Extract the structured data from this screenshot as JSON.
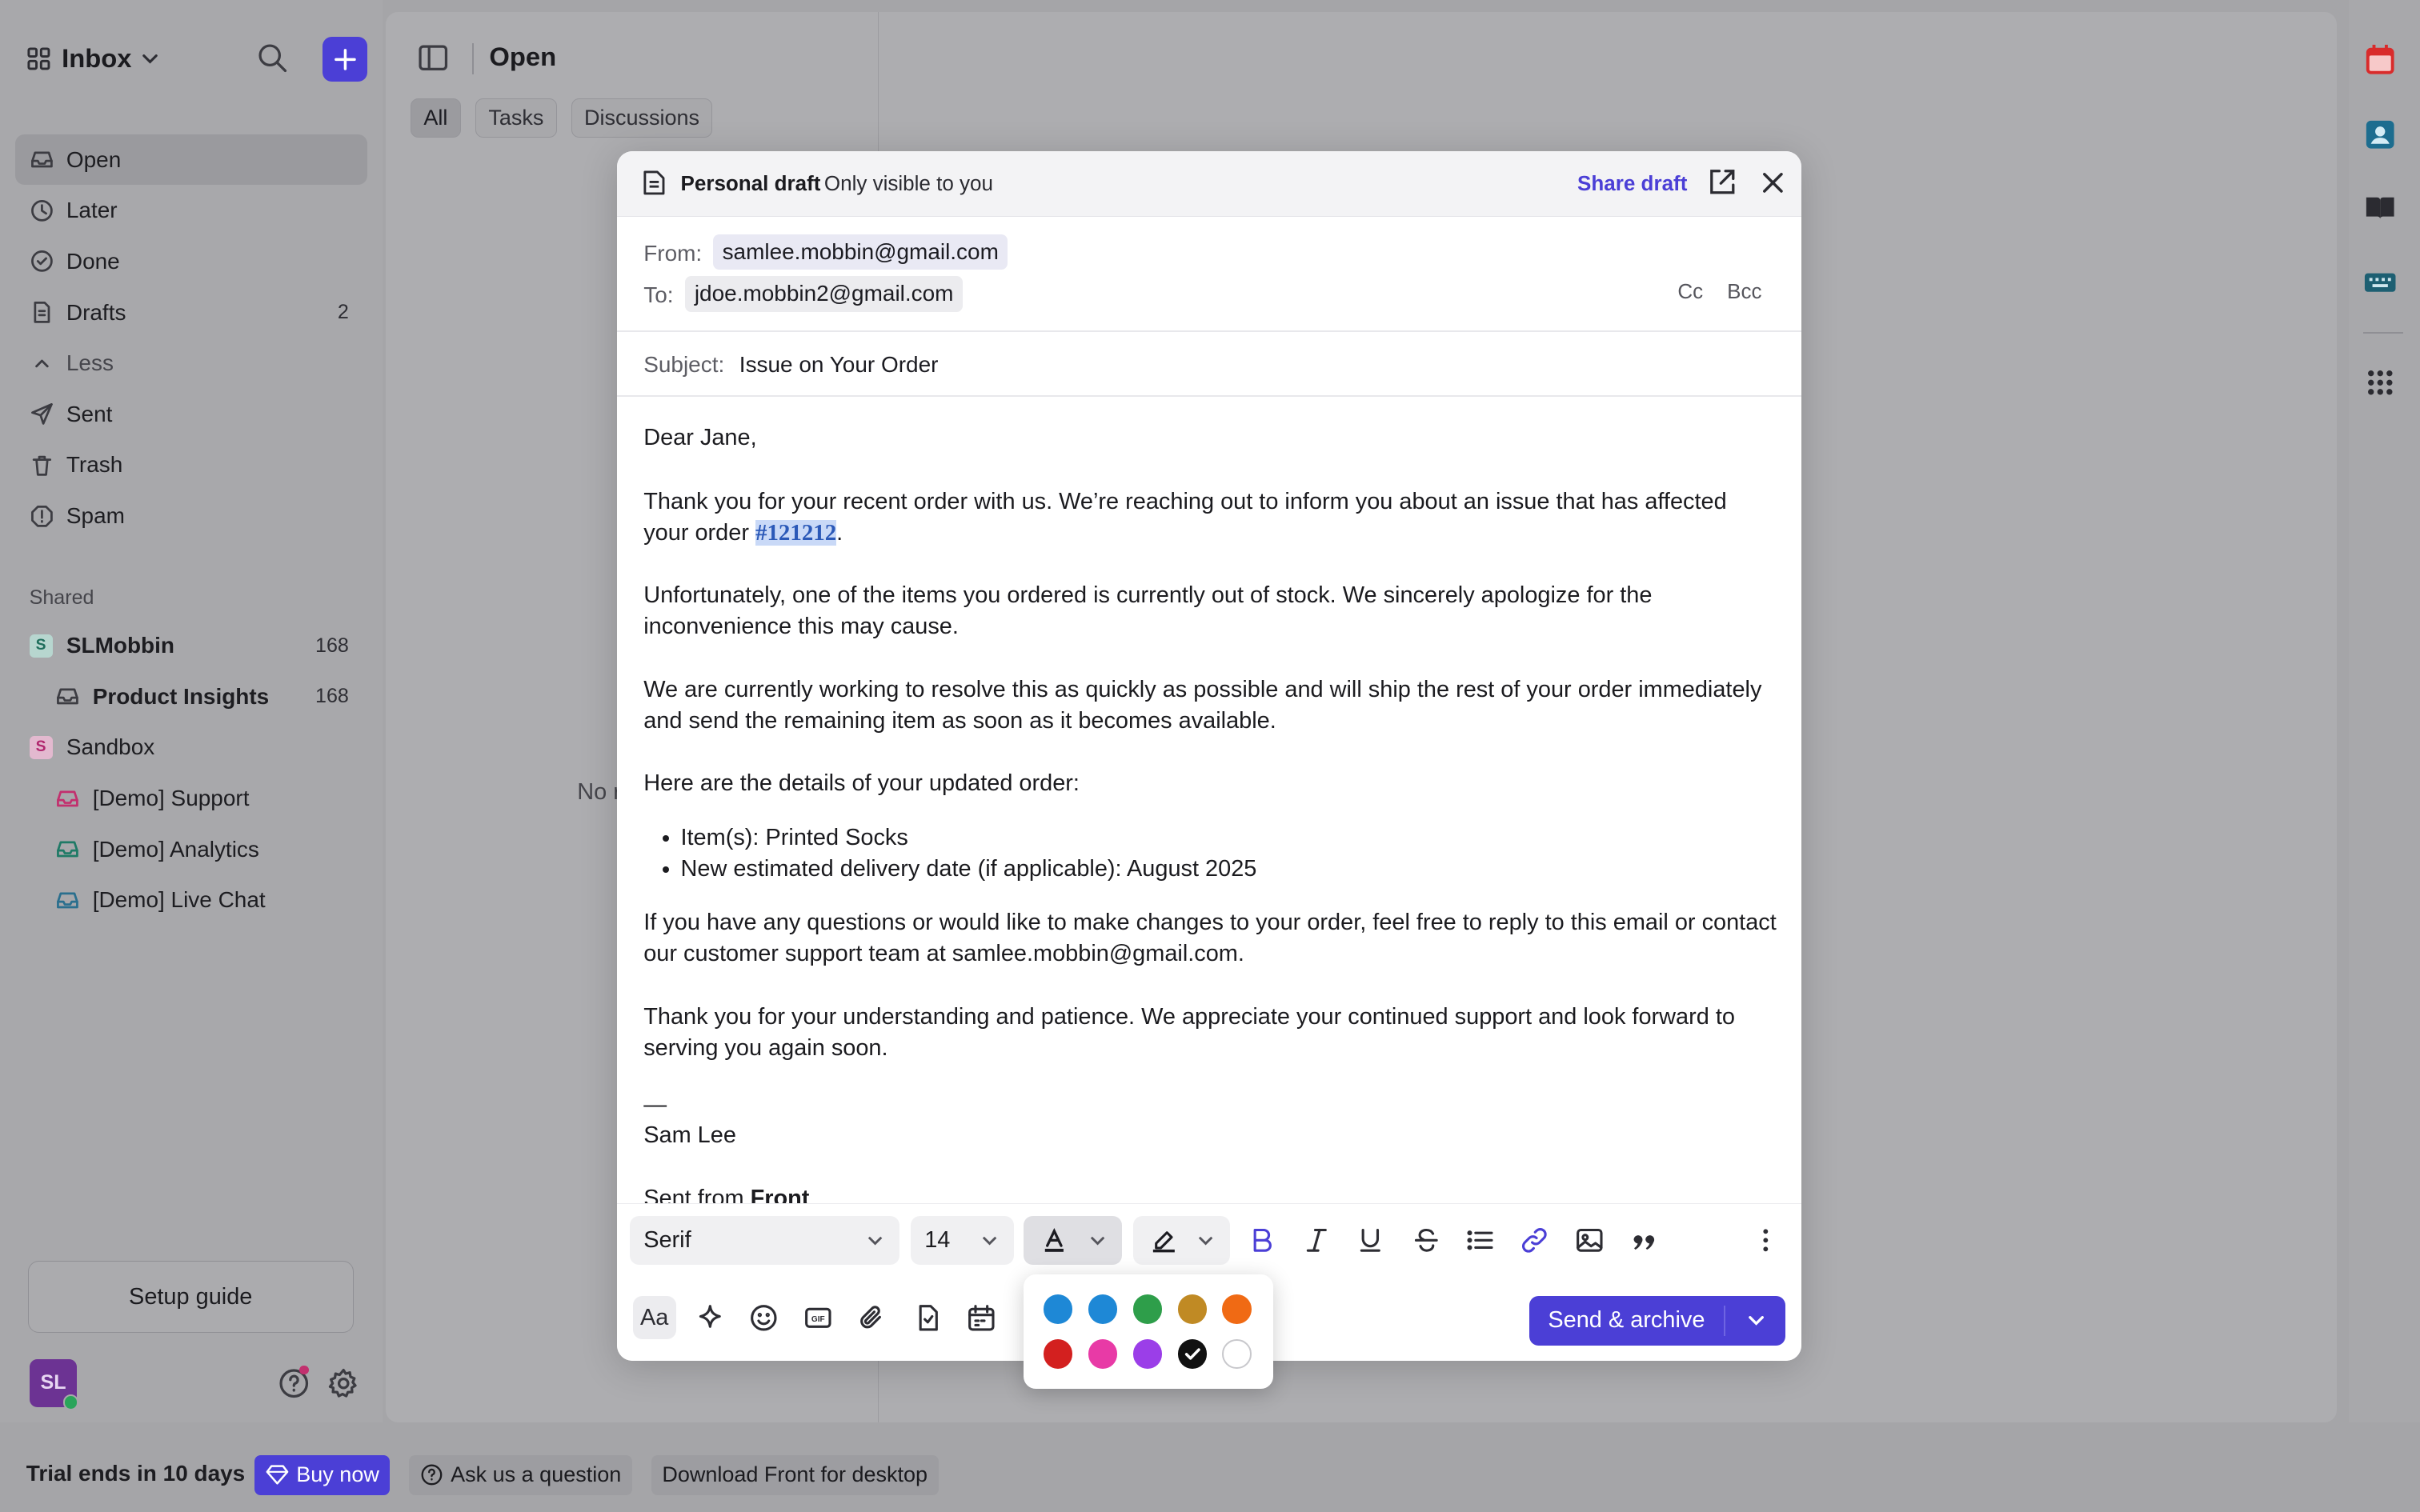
{
  "sidebar": {
    "inbox_title": "Inbox",
    "nav": [
      {
        "label": "Open",
        "icon": "inbox-icon",
        "count": ""
      },
      {
        "label": "Later",
        "icon": "clock-icon",
        "count": ""
      },
      {
        "label": "Done",
        "icon": "check-circle-icon",
        "count": ""
      },
      {
        "label": "Drafts",
        "icon": "draft-icon",
        "count": "2"
      },
      {
        "label": "Less",
        "icon": "chevron-up-icon",
        "count": ""
      },
      {
        "label": "Sent",
        "icon": "send-icon",
        "count": ""
      },
      {
        "label": "Trash",
        "icon": "trash-icon",
        "count": ""
      },
      {
        "label": "Spam",
        "icon": "spam-icon",
        "count": ""
      }
    ],
    "shared_heading": "Shared",
    "workspaces": [
      {
        "label": "SLMobbin",
        "badge": "S",
        "count": "168"
      },
      {
        "label": "Product Insights",
        "count": "168"
      },
      {
        "label": "Sandbox",
        "badge": "S",
        "count": ""
      },
      {
        "label": "[Demo] Support",
        "count": ""
      },
      {
        "label": "[Demo] Analytics",
        "count": ""
      },
      {
        "label": "[Demo] Live Chat",
        "count": ""
      }
    ],
    "setup_guide": "Setup guide",
    "avatar_initials": "SL"
  },
  "main": {
    "title": "Open",
    "filters": [
      "All",
      "Tasks",
      "Discussions"
    ],
    "empty_text": "No r"
  },
  "compose": {
    "header_title": "Personal draft",
    "header_sub": "Only visible to you",
    "share_draft": "Share draft",
    "from_label": "From:",
    "from_value": "samlee.mobbin@gmail.com",
    "to_label": "To:",
    "to_value": "jdoe.mobbin2@gmail.com",
    "cc": "Cc",
    "bcc": "Bcc",
    "subject_label": "Subject:",
    "subject_value": "Issue on Your Order",
    "body": {
      "greeting": "Dear Jane,",
      "p1_start": "Thank you for your recent order with us. We’re reaching out to inform you about an issue that has affected your order ",
      "p1_highlight": "#121212",
      "p1_end": ".",
      "p2": "Unfortunately, one of the items you ordered is currently out of stock. We sincerely apologize for the inconvenience this may cause.",
      "p3": "We are currently working to resolve this as quickly as possible and will ship the rest of your order immediately and send the remaining item as soon as it becomes available.",
      "p4": "Here are the details of your updated order:",
      "bullets": [
        "Item(s): Printed Socks",
        "New estimated delivery date (if applicable): August 2025"
      ],
      "p5": "If you have any questions or would like to make changes to your order, feel free to reply to this email or contact our customer support team at samlee.mobbin@gmail.com.",
      "p6": "Thank you for your understanding and patience. We appreciate your continued support and look forward to serving you again soon.",
      "sig_dash": "—",
      "sig_name": "Sam Lee",
      "sent_from": "Sent from ",
      "sent_from_brand": "Front"
    },
    "font_family": "Serif",
    "font_size": "14",
    "send_button": "Send & archive"
  },
  "color_picker": {
    "swatches": [
      "#1e88d6",
      "#1e88d6",
      "#2e9e4a",
      "#c08a24",
      "#f06a14",
      "#d3201f",
      "#e83aa6",
      "#9b3ee8",
      "#111111",
      "#ffffff"
    ],
    "selected_index": 8
  },
  "bottom_bar": {
    "trial": "Trial ends in 10 days",
    "buy_now": "Buy now",
    "ask": "Ask us a question",
    "download": "Download Front for desktop"
  }
}
